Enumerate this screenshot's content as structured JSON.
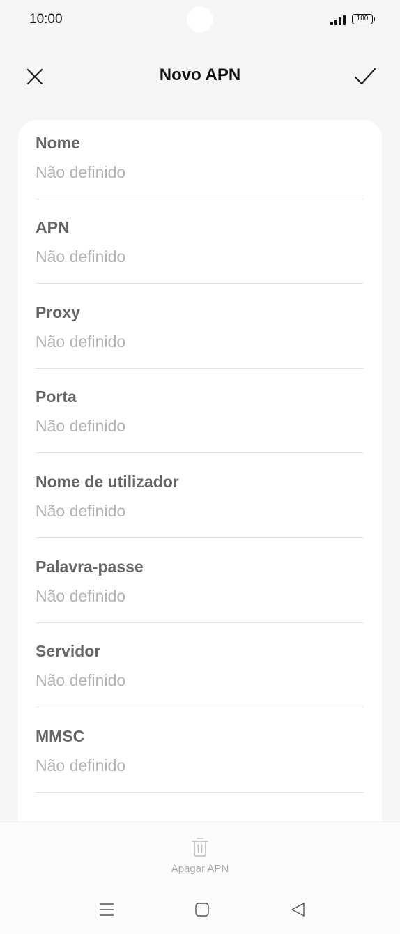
{
  "status_bar": {
    "time": "10:00",
    "battery": "100",
    "icons": [
      "signal-icon",
      "battery-icon"
    ]
  },
  "header": {
    "title": "Novo APN",
    "close_icon": "close-icon",
    "confirm_icon": "check-icon"
  },
  "fields": [
    {
      "label": "Nome",
      "value": "Não definido"
    },
    {
      "label": "APN",
      "value": "Não definido"
    },
    {
      "label": "Proxy",
      "value": "Não definido"
    },
    {
      "label": "Porta",
      "value": "Não definido"
    },
    {
      "label": "Nome de utilizador",
      "value": "Não definido"
    },
    {
      "label": "Palavra-passe",
      "value": "Não definido"
    },
    {
      "label": "Servidor",
      "value": "Não definido"
    },
    {
      "label": "MMSC",
      "value": "Não definido"
    }
  ],
  "bottom_action": {
    "label": "Apagar APN",
    "icon": "trash-icon"
  },
  "nav_bar": {
    "icons": [
      "menu-icon",
      "home-icon",
      "back-icon"
    ]
  },
  "colors": {
    "background": "#f5f5f5",
    "card": "#ffffff",
    "label": "#666666",
    "placeholder": "#b3b3b3",
    "disabled": "#a8a8a8"
  }
}
